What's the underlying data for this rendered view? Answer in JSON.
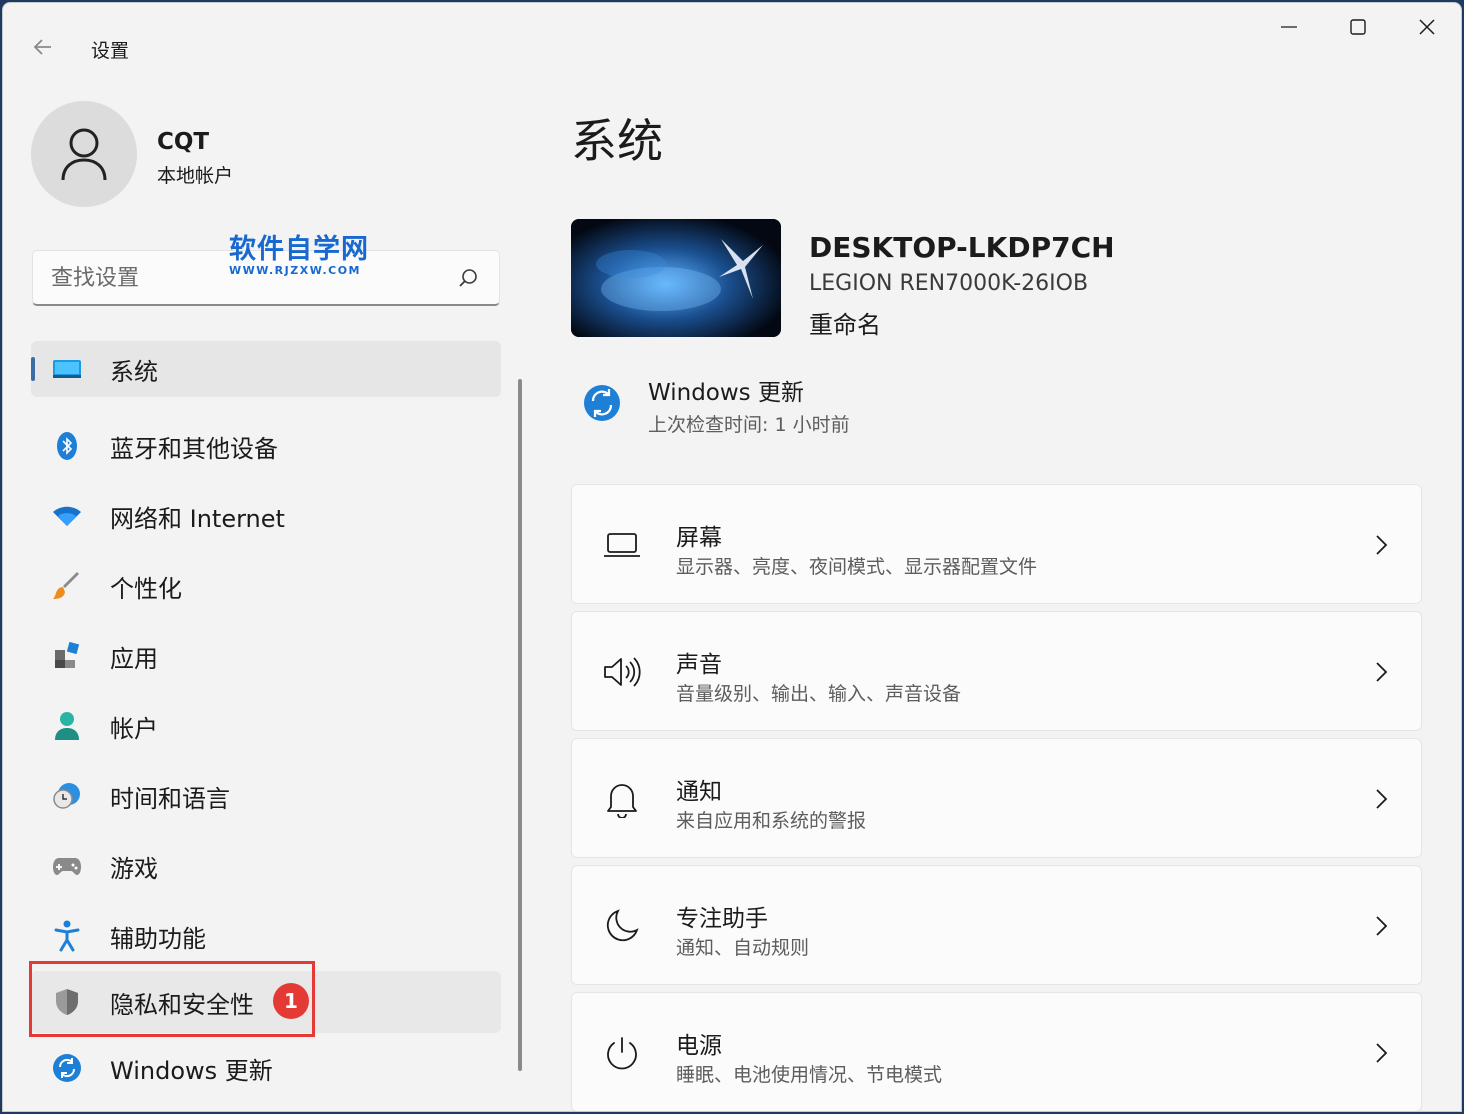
{
  "titlebar": {
    "app_title": "设置",
    "controls": {
      "minimize": "minimize-icon",
      "maximize": "maximize-icon",
      "close": "close-icon"
    }
  },
  "profile": {
    "name": "CQT",
    "account_type": "本地帐户"
  },
  "search": {
    "placeholder": "查找设置"
  },
  "watermark": {
    "title": "软件自学网",
    "url": "WWW.RJZXW.COM"
  },
  "sidebar": {
    "items": [
      {
        "label": "系统",
        "icon": "display-icon",
        "selected": true
      },
      {
        "label": "蓝牙和其他设备",
        "icon": "bluetooth-icon"
      },
      {
        "label": "网络和 Internet",
        "icon": "wifi-icon"
      },
      {
        "label": "个性化",
        "icon": "brush-icon"
      },
      {
        "label": "应用",
        "icon": "apps-icon"
      },
      {
        "label": "帐户",
        "icon": "person-icon"
      },
      {
        "label": "时间和语言",
        "icon": "clock-globe-icon"
      },
      {
        "label": "游戏",
        "icon": "gamepad-icon"
      },
      {
        "label": "辅助功能",
        "icon": "accessibility-icon"
      },
      {
        "label": "隐私和安全性",
        "icon": "shield-icon",
        "highlighted": true
      },
      {
        "label": "Windows 更新",
        "icon": "update-icon"
      }
    ],
    "annotation_step": "1"
  },
  "main": {
    "title": "系统",
    "device": {
      "name": "DESKTOP-LKDP7CH",
      "model": "LEGION REN7000K-26IOB",
      "rename_label": "重命名"
    },
    "windows_update": {
      "title": "Windows 更新",
      "subtitle": "上次检查时间: 1 小时前"
    },
    "cards": [
      {
        "title": "屏幕",
        "subtitle": "显示器、亮度、夜间模式、显示器配置文件",
        "icon": "laptop-icon"
      },
      {
        "title": "声音",
        "subtitle": "音量级别、输出、输入、声音设备",
        "icon": "speaker-icon"
      },
      {
        "title": "通知",
        "subtitle": "来自应用和系统的警报",
        "icon": "bell-icon"
      },
      {
        "title": "专注助手",
        "subtitle": "通知、自动规则",
        "icon": "moon-icon"
      },
      {
        "title": "电源",
        "subtitle": "睡眠、电池使用情况、节电模式",
        "icon": "power-icon"
      }
    ]
  },
  "colors": {
    "accent": "#3b6ea5",
    "annotation_red": "#e53935",
    "watermark_blue": "#1769d1"
  }
}
